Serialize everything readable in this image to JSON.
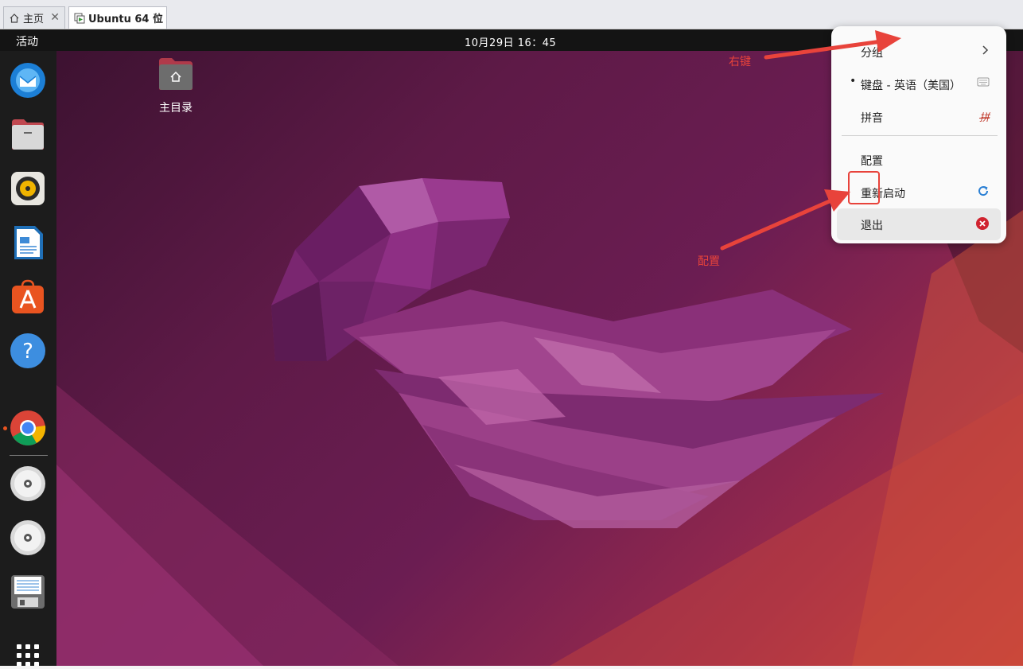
{
  "tabs": [
    {
      "label": "主页",
      "icon": "home-icon"
    },
    {
      "label": "Ubuntu 64 位",
      "icon": "vm-icon"
    }
  ],
  "topbar": {
    "activities": "活动",
    "clock": "10月29日  16：45"
  },
  "desktop": {
    "home_folder_label": "主目录"
  },
  "dock": {
    "items": [
      "thunderbird-icon",
      "files-icon",
      "rhythmbox-icon",
      "libreoffice-writer-icon",
      "app-center-icon",
      "help-icon",
      "chrome-icon",
      "dvd-drive-icon",
      "dvd-drive-icon",
      "floppy-drive-icon",
      "show-apps-icon"
    ]
  },
  "menu": {
    "group_label": "分组",
    "keyboard_label": "键盘 - 英语（美国）",
    "keyboard_bullet": "•",
    "pinyin_label": "拼音",
    "pinyin_glyph": "拼",
    "config_label": "配置",
    "restart_label": "重新启动",
    "quit_label": "退出"
  },
  "annotations": {
    "right_click": "右键",
    "config": "配置",
    "color": "#e8433b"
  }
}
